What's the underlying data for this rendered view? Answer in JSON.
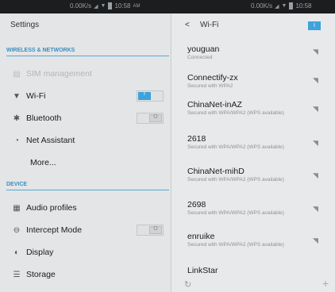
{
  "status": {
    "left_speed": "0.00K/s",
    "left_time": "10:58",
    "left_ampm": "AM",
    "right_speed": "0.00K/s",
    "right_time": "10:58"
  },
  "settings": {
    "title": "Settings",
    "sections": [
      {
        "label": "WIRELESS & NETWORKS"
      },
      {
        "label": "DEVICE"
      }
    ],
    "items": [
      {
        "label": "SIM management",
        "icon": "sim-icon",
        "glyph": "▤",
        "disabled": true
      },
      {
        "label": "Wi-Fi",
        "icon": "wifi-icon",
        "glyph": "▼",
        "toggle": "on",
        "toggle_text": "I"
      },
      {
        "label": "Bluetooth",
        "icon": "bluetooth-icon",
        "glyph": "✱",
        "toggle": "off",
        "toggle_text": "O"
      },
      {
        "label": "Net Assistant",
        "icon": "net-assistant-icon",
        "glyph": "◔"
      },
      {
        "label": "More...",
        "icon": "",
        "glyph": ""
      },
      {
        "label": "Audio profiles",
        "icon": "audio-profiles-icon",
        "glyph": "▦"
      },
      {
        "label": "Intercept Mode",
        "icon": "intercept-icon",
        "glyph": "⊖",
        "toggle": "off",
        "toggle_text": "O"
      },
      {
        "label": "Display",
        "icon": "display-icon",
        "glyph": "◐"
      },
      {
        "label": "Storage",
        "icon": "storage-icon",
        "glyph": "☰"
      }
    ]
  },
  "wifi_panel": {
    "back": "<",
    "title": "Wi-Fi",
    "wps_label": "I",
    "networks": [
      {
        "ssid": "youguan",
        "status": "Connected"
      },
      {
        "ssid": "Connectify-zx",
        "status": "Secured with WPA2"
      },
      {
        "ssid": "ChinaNet-inAZ",
        "status": "Secured with WPA/WPA2 (WPS available)"
      },
      {
        "ssid": "2618",
        "status": "Secured with WPA/WPA2 (WPS available)"
      },
      {
        "ssid": "ChinaNet-mihD",
        "status": "Secured with WPA/WPA2 (WPS available)"
      },
      {
        "ssid": "2698",
        "status": "Secured with WPA/WPA2 (WPS available)"
      },
      {
        "ssid": "enruike",
        "status": "Secured with WPA/WPA2 (WPS available)"
      },
      {
        "ssid": "LinkStar",
        "status": ""
      }
    ],
    "signal_glyph": "◥",
    "scan_glyph": "↻",
    "add_glyph": "+"
  },
  "colors": {
    "accent": "#3da3da",
    "section": "#3a8fbf"
  }
}
